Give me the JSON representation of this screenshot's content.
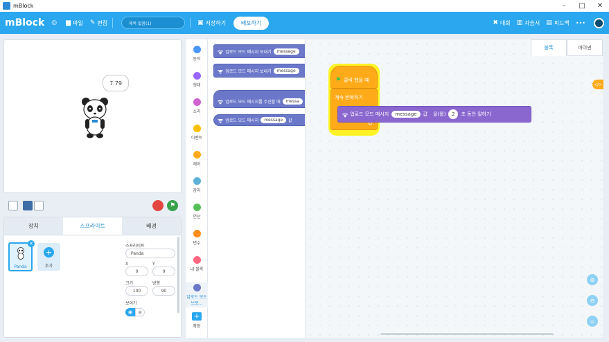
{
  "window": {
    "title": "mBlock",
    "controls": [
      "–",
      "□",
      "✕"
    ]
  },
  "menubar": {
    "logo": "mBlock",
    "file": "파일",
    "edit": "편집",
    "project_name": "제목 없음(1)",
    "save": "저장하기",
    "publish": "배포하기",
    "right": {
      "contest": "대회",
      "tutorial": "자습서",
      "feedback": "피드백",
      "more": "•••"
    }
  },
  "stage": {
    "bubble": "7.79"
  },
  "panel": {
    "tabs": [
      "장치",
      "스프라이트",
      "배경"
    ],
    "sprite_name": "Panda",
    "add_label": "추가",
    "props": {
      "sprite_label": "스프라이트",
      "sprite_value": "Panda",
      "x_label": "X",
      "x_value": "0",
      "y_label": "Y",
      "y_value": "0",
      "size_label": "크기",
      "size_value": "100",
      "direction_label": "방향",
      "direction_value": "90",
      "show_label": "보이기"
    }
  },
  "categories": [
    {
      "label": "동작",
      "color": "#4c97ff"
    },
    {
      "label": "형태",
      "color": "#9966ff"
    },
    {
      "label": "소리",
      "color": "#cf63cf"
    },
    {
      "label": "이벤트",
      "color": "#ffbf00"
    },
    {
      "label": "제어",
      "color": "#ffab19"
    },
    {
      "label": "감지",
      "color": "#5cb1d6"
    },
    {
      "label": "연산",
      "color": "#59c059"
    },
    {
      "label": "변수",
      "color": "#ff8c1a"
    },
    {
      "label": "내 블록",
      "color": "#ff6680"
    },
    {
      "label": "업로드 모드 브로...",
      "color": "#6b78c9"
    },
    {
      "label": "확장",
      "color": "#2aa7ee"
    }
  ],
  "palette": {
    "blocks": [
      {
        "text": "업로드 모드 메시지 보내기",
        "slot": "message"
      },
      {
        "text": "업로드 모드 메시지 보내기",
        "slot": "message"
      },
      {
        "text": "업로드 모드 메시지를 수신할 때",
        "slot": "messa"
      },
      {
        "text": "업로드 모드 메시지",
        "slot": "message",
        "suffix": "값"
      }
    ]
  },
  "script": {
    "code_tabs": [
      "블록",
      "파이썬"
    ],
    "toggle_code": "</>",
    "hat": "클릭 했을 때",
    "forever": "계속 반복하기",
    "say": {
      "text": "업로드 모드 메시지",
      "slot": "message",
      "part2": "값",
      "part3": "을(를)",
      "num": "2",
      "part4": "초 동안 말하기"
    }
  },
  "colors": {
    "accent": "#2aa7ee",
    "control": "#ffab19",
    "extension": "#6b78c9"
  }
}
